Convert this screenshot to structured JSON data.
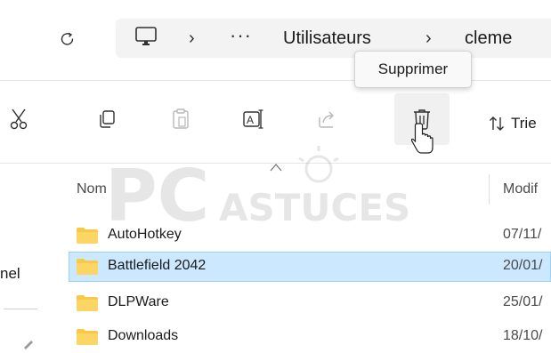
{
  "address_bar": {
    "path": [
      "Utilisateurs",
      "cleme"
    ],
    "overflow_label": "···",
    "separator": "›"
  },
  "toolbar": {
    "buttons": [
      {
        "name": "cut",
        "icon": "scissors-icon"
      },
      {
        "name": "copy",
        "icon": "copy-icon"
      },
      {
        "name": "paste",
        "icon": "paste-icon",
        "enabled": false
      },
      {
        "name": "rename",
        "icon": "rename-icon"
      },
      {
        "name": "share",
        "icon": "share-icon",
        "enabled": false
      },
      {
        "name": "delete",
        "icon": "trash-icon",
        "hovered": true
      }
    ],
    "sort_label": "Trie"
  },
  "tooltip": {
    "text": "Supprimer"
  },
  "nav_pane": {
    "visible_label": "nel"
  },
  "columns": {
    "name": "Nom",
    "modified": "Modif"
  },
  "files": [
    {
      "name": "AutoHotkey",
      "date": "07/11/",
      "selected": false
    },
    {
      "name": "Battlefield 2042",
      "date": "20/01/",
      "selected": true
    },
    {
      "name": "DLPWare",
      "date": "25/01/",
      "selected": false
    },
    {
      "name": "Downloads",
      "date": "18/10/",
      "selected": false
    }
  ],
  "watermark": {
    "text_main": "PC",
    "text_sub": "ASTUCES"
  },
  "colors": {
    "selection_bg": "#cce8ff",
    "selection_border": "#99d1ff",
    "folder": "#f8c847",
    "accent": "#0067c0"
  }
}
